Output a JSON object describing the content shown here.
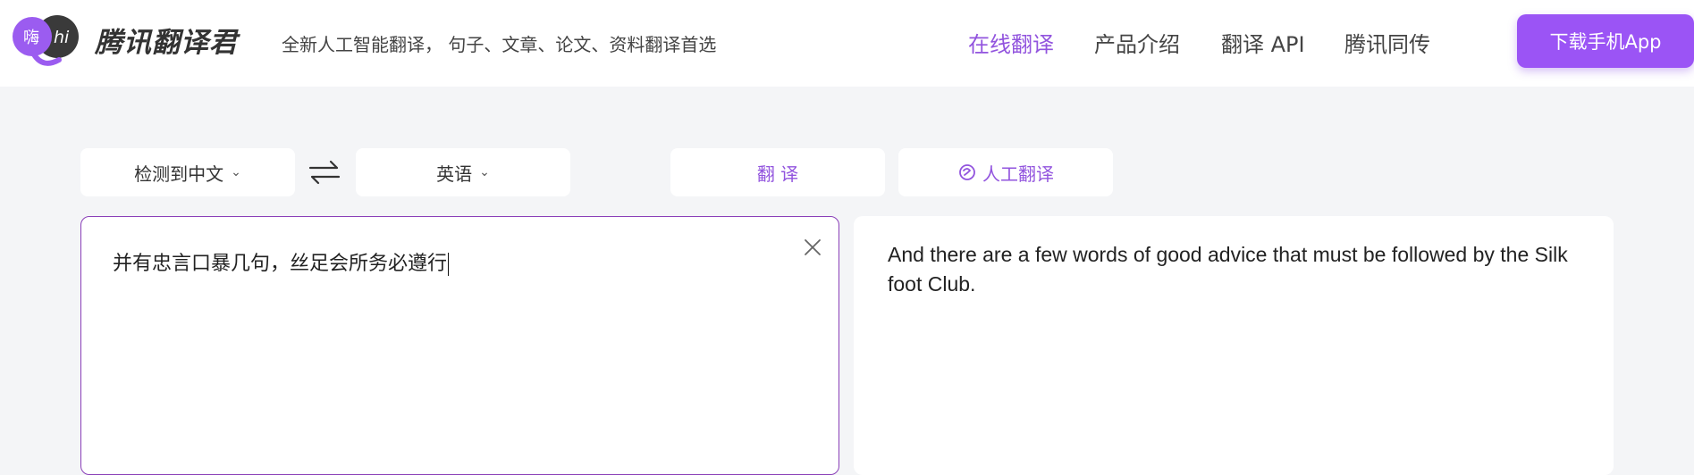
{
  "header": {
    "logo_badge": "嗨",
    "logo_hi": "hi",
    "brand": "腾讯翻译君",
    "slogan": "全新人工智能翻译， 句子、文章、论文、资料翻译首选",
    "nav": [
      {
        "label": "在线翻译",
        "active": true
      },
      {
        "label": "产品介绍",
        "active": false
      },
      {
        "label": "翻译 API",
        "active": false
      },
      {
        "label": "腾讯同传",
        "active": false
      }
    ],
    "download_label": "下载手机App"
  },
  "toolbar": {
    "source_lang": "检测到中文",
    "target_lang": "英语",
    "translate_label": "翻 译",
    "human_translate_label": "人工翻译",
    "caret": "⌄"
  },
  "source": {
    "text": "并有忠言口暴几句，丝足会所务必遵行"
  },
  "result": {
    "text": "And there are a few words of good advice that must be followed by the Silk foot Club."
  },
  "colors": {
    "accent": "#9254de",
    "button": "#9b54f5",
    "background": "#f4f5f7",
    "input_border": "#8a3fb8"
  }
}
